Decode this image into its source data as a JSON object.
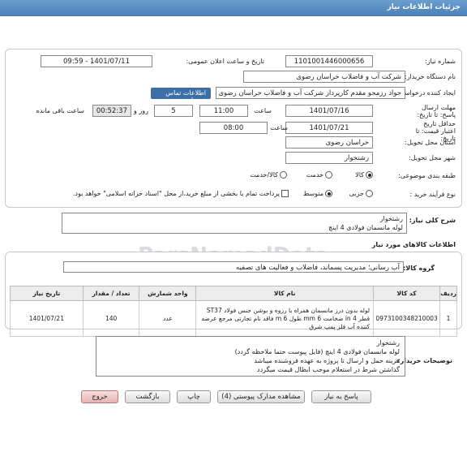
{
  "header": {
    "title": "جزئیات اطلاعات نیاز"
  },
  "fields": {
    "need_number_label": "شماره نیاز:",
    "need_number": "1101001446000656",
    "announce_label": "تاریخ و ساعت اعلان عمومی:",
    "announce_value": "1401/07/11 - 09:59",
    "buyer_org_label": "نام دستگاه خریدار:",
    "buyer_org": "شرکت آب و فاضلاب خراسان رضوی",
    "requester_label": "ایجاد کننده درخواست:",
    "requester": "جواد رزمجو مقدم  کارپرداز شرکت آب و فاضلاب خراسان رضوی",
    "contact_link": "اطلاعات تماس خریدار",
    "deadline_label": "مهلت ارسال پاسخ: تا تاریخ:",
    "deadline_date": "1401/07/16",
    "time_label": "ساعت",
    "deadline_time": "11:00",
    "days_value": "5",
    "days_label": "روز و",
    "remaining_time": "00:52:37",
    "remaining_label": "ساعت باقی مانده",
    "validity_label": "حداقل تاریخ اعتبار قیمت: تا تاریخ:",
    "validity_date": "1401/07/21",
    "validity_time_label": "ساعت",
    "validity_time": "08:00",
    "province_label": "استان محل تحویل:",
    "province": "خراسان رضوی",
    "city_label": "شهر محل تحویل:",
    "city": "رشتخوار",
    "category_label": "طبقه بندی موضوعی:",
    "category_options": [
      "کالا",
      "خدمت",
      "کالا/خدمت"
    ],
    "process_label": "نوع فرآیند خرید :",
    "process_options": [
      "جزیی",
      "متوسط"
    ],
    "payment_note": "پرداخت تمام یا بخشی از مبلغ خرید،از محل \"اسناد خزانه اسلامی\" خواهد بود."
  },
  "summary": {
    "label": "شرح کلی نیاز:",
    "line1": "رشتخوار",
    "line2": "لوله مانسمان فولادی 4 اینچ"
  },
  "goods": {
    "section_title": "اطلاعات کالاهای مورد نیاز",
    "group_label": "گروه کالا:",
    "group_value": "آب رسانی؛ مدیریت پسماند، فاضلاب و فعالیت های تصفیه",
    "columns": [
      "ردیف",
      "کد کالا",
      "نام کالا",
      "واحد شمارش",
      "تعداد / مقدار",
      "تاریخ نیاز"
    ],
    "rows": [
      {
        "index": "1",
        "code": "0973100348210003",
        "name": "لوله بدون درز مانسمان همراه با رزوه و بوشن جنس فولاد ST37 قطر 4 in ضخامت 6 mm طول 6 m فاقد نام تجارتی مرجع عرضه کننده آب فلز پمپ شرق",
        "unit": "عدد",
        "qty": "140",
        "date": "1401/07/21"
      }
    ]
  },
  "buyer_notes": {
    "label": "توضیحات خریدار:",
    "lines": [
      "رشتخوار",
      "لوله مانسمان فولادی 4 اینچ (فایل پیوست حتما ملاحظه گردد)",
      "هزینه حمل و ارسال تا پروژه به عهده فروشنده میباشد",
      "گذاشتن شرط در استعلام موجب ابطال قیمت میگردد"
    ]
  },
  "buttons": {
    "reply": "پاسخ به نیاز",
    "attachments": "مشاهده مدارک پیوستی (4)",
    "print": "چاپ",
    "back": "بازگشت",
    "exit": "خروج"
  },
  "watermark": "ParsNamadData"
}
